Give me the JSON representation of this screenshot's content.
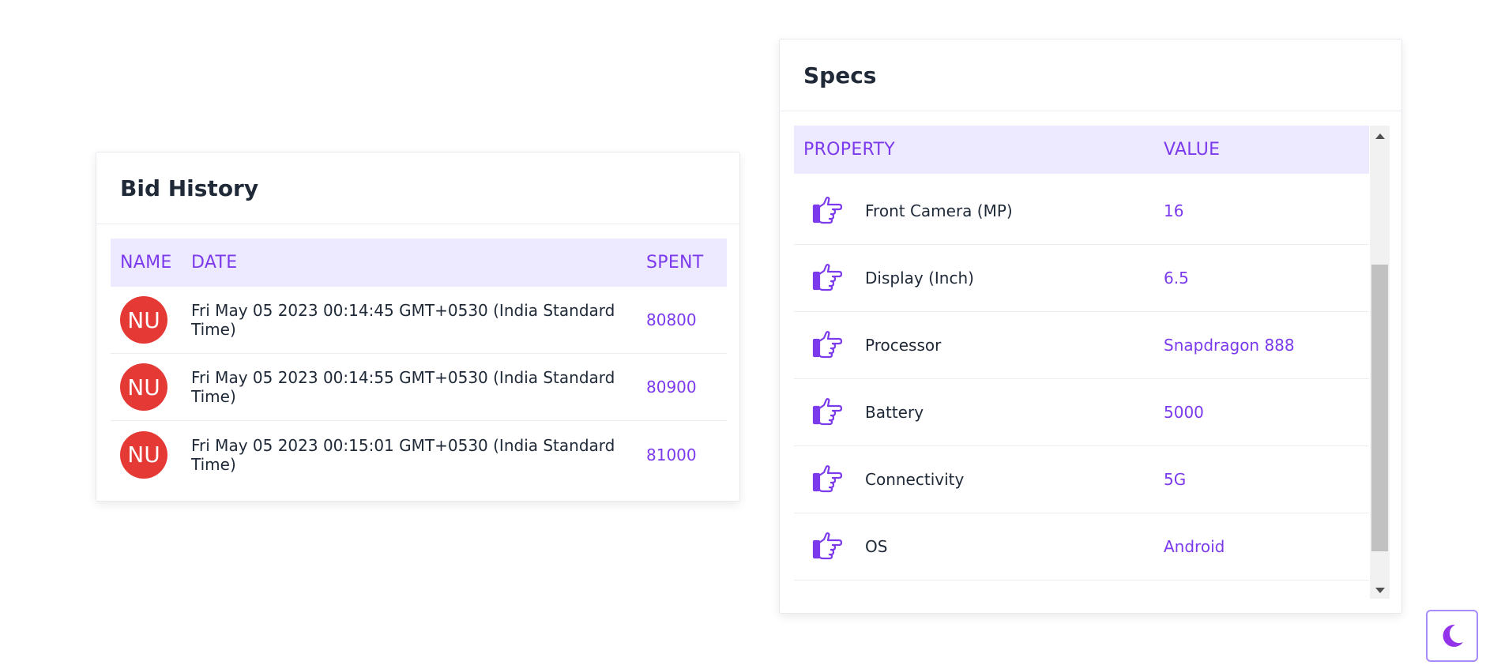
{
  "bid_history": {
    "title": "Bid History",
    "columns": [
      "NAME",
      "DATE",
      "SPENT"
    ],
    "rows": [
      {
        "avatar": "NU",
        "date": "Fri May 05 2023 00:14:45 GMT+0530 (India Standard Time)",
        "spent": "80800"
      },
      {
        "avatar": "NU",
        "date": "Fri May 05 2023 00:14:55 GMT+0530 (India Standard Time)",
        "spent": "80900"
      },
      {
        "avatar": "NU",
        "date": "Fri May 05 2023 00:15:01 GMT+0530 (India Standard Time)",
        "spent": "81000"
      }
    ]
  },
  "specs": {
    "title": "Specs",
    "columns": [
      "PROPERTY",
      "VALUE"
    ],
    "row_icon": "pointing-hand-icon",
    "rows": [
      {
        "property": "Front Camera (MP)",
        "value": "16"
      },
      {
        "property": "Display (Inch)",
        "value": "6.5"
      },
      {
        "property": "Processor",
        "value": "Snapdragon 888"
      },
      {
        "property": "Battery",
        "value": "5000"
      },
      {
        "property": "Connectivity",
        "value": "5G"
      },
      {
        "property": "OS",
        "value": "Android"
      }
    ]
  },
  "theme_toggle": {
    "icon": "moon-icon"
  },
  "colors": {
    "accent": "#7c3aed",
    "header_bg": "#ede9fe",
    "avatar_bg": "#e53935"
  }
}
